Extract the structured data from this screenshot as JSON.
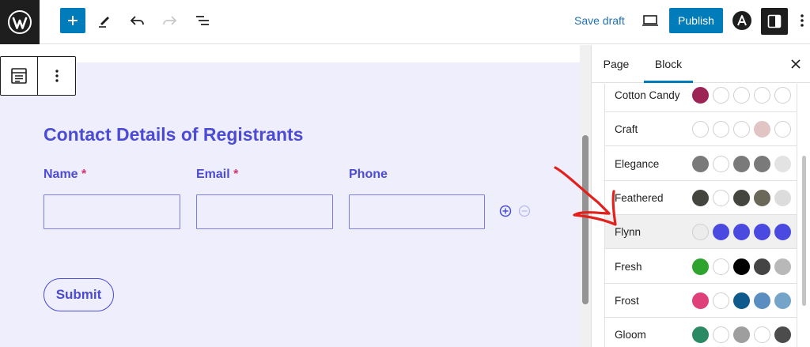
{
  "topbar": {
    "save_draft_label": "Save draft",
    "publish_label": "Publish",
    "accent_color": "#007cba"
  },
  "form": {
    "title": "Contact Details of Registrants",
    "required_marker": "*",
    "fields": [
      {
        "label": "Name",
        "required": true,
        "value": ""
      },
      {
        "label": "Email",
        "required": true,
        "value": ""
      },
      {
        "label": "Phone",
        "required": false,
        "value": ""
      }
    ],
    "submit_label": "Submit",
    "theme_color": "#4b4bd6"
  },
  "sidebar": {
    "tabs": [
      {
        "label": "Page",
        "active": false
      },
      {
        "label": "Block",
        "active": true
      }
    ],
    "palettes": [
      {
        "name": "Cotton Candy",
        "selected": false,
        "colors": [
          "#9c2456",
          "#ffffff",
          "#ffffff",
          "#ffffff",
          "#ffffff"
        ]
      },
      {
        "name": "Craft",
        "selected": false,
        "colors": [
          "#ffffff",
          "#ffffff",
          "#ffffff",
          "#e1c4c4",
          "#ffffff"
        ]
      },
      {
        "name": "Elegance",
        "selected": false,
        "colors": [
          "#7a7a7a",
          "#ffffff",
          "#7a7a7a",
          "#7a7a7a",
          "#e3e3e3"
        ]
      },
      {
        "name": "Feathered",
        "selected": false,
        "colors": [
          "#454540",
          "#ffffff",
          "#454540",
          "#6a6858",
          "#dcdcdc"
        ]
      },
      {
        "name": "Flynn",
        "selected": true,
        "colors": [
          "#ececec",
          "#4a4ae0",
          "#4a4ae0",
          "#4a4ae0",
          "#4a4ae0"
        ]
      },
      {
        "name": "Fresh",
        "selected": false,
        "colors": [
          "#2ea32e",
          "#ffffff",
          "#000000",
          "#444444",
          "#b8b8b8"
        ]
      },
      {
        "name": "Frost",
        "selected": false,
        "colors": [
          "#e0407a",
          "#ffffff",
          "#0f5a8c",
          "#5a8ec0",
          "#74a4c8"
        ]
      },
      {
        "name": "Gloom",
        "selected": false,
        "colors": [
          "#2a8a64",
          "#ffffff",
          "#9e9e9e",
          "#ffffff",
          "#4c4c4c"
        ]
      }
    ]
  },
  "annotation": {
    "arrow_color": "#e2201c"
  }
}
